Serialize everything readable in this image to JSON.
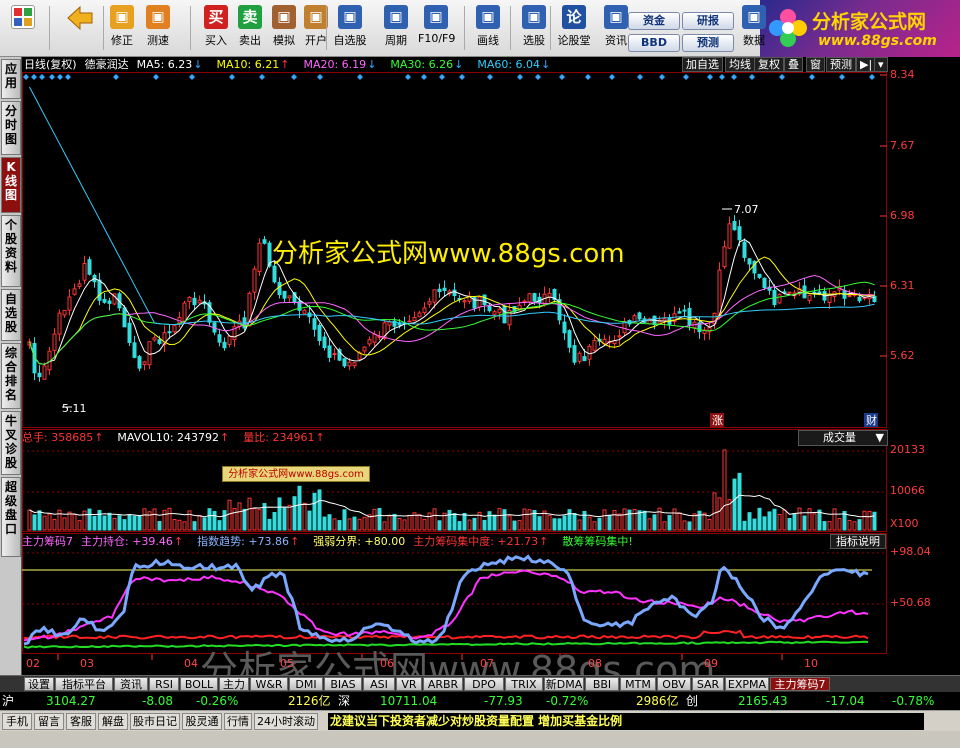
{
  "toolbar": {
    "buttons": [
      {
        "key": "modify",
        "label": "修正",
        "icon": "up-down-arrows-icon",
        "color": "#e8a020"
      },
      {
        "key": "measure",
        "label": "测速",
        "icon": "stopwatch-icon",
        "color": "#e08020"
      },
      {
        "key": "buy",
        "label": "买入",
        "icon_text": "买",
        "color": "#d02020"
      },
      {
        "key": "sell",
        "label": "卖出",
        "icon_text": "卖",
        "color": "#20a040"
      },
      {
        "key": "simulate",
        "label": "模拟",
        "icon": "hammer-icon",
        "color": "#a06030"
      },
      {
        "key": "open",
        "label": "开户",
        "icon": "lock-icon",
        "color": "#c08030"
      },
      {
        "key": "watchlist",
        "label": "自选股",
        "icon": "star-window-icon",
        "color": "#3060b0"
      },
      {
        "key": "period",
        "label": "周期",
        "icon": "clock-icon",
        "color": "#3060b0"
      },
      {
        "key": "f10",
        "label": "F10/F9",
        "icon": "document-window-icon",
        "color": "#3060b0"
      },
      {
        "key": "draw",
        "label": "画线",
        "icon": "pencil-icon",
        "color": "#3060b0"
      },
      {
        "key": "pick",
        "label": "选股",
        "icon": "chart-window-icon",
        "color": "#3060b0"
      },
      {
        "key": "forum",
        "label": "论股堂",
        "icon_text": "论",
        "color": "#2050a0"
      },
      {
        "key": "news",
        "label": "资讯",
        "icon": "globe-icon",
        "color": "#3060b0"
      },
      {
        "key": "data",
        "label": "数据",
        "icon": "pe-icon",
        "color": "#3060b0"
      }
    ],
    "pills": [
      "资金",
      "研报",
      "BBD",
      "预测"
    ]
  },
  "logo": {
    "title": "分析家公式网",
    "url": "www.88gs.com"
  },
  "sidebar": [
    "应用",
    "分时图",
    "K线图",
    "个股资料",
    "自选股",
    "综合排名",
    "牛叉诊股",
    "超级盘口"
  ],
  "legend_main": [
    {
      "text": "日线(复权)",
      "color": "#ffffff"
    },
    {
      "text": "德豪润达",
      "color": "#ffffff"
    },
    {
      "text": "MA5: 6.23",
      "color": "#ffffff",
      "arrow": "↓",
      "arrow_color": "#33aaff"
    },
    {
      "text": "MA10: 6.21",
      "color": "#ffff00",
      "arrow": "↑",
      "arrow_color": "#ff3333"
    },
    {
      "text": "MA20: 6.19",
      "color": "#ff66ff",
      "arrow": "↓",
      "arrow_color": "#33aaff"
    },
    {
      "text": "MA30: 6.26",
      "color": "#33ff33",
      "arrow": "↓",
      "arrow_color": "#33aaff"
    },
    {
      "text": "MA60: 6.04",
      "color": "#33ccff",
      "arrow": "↓",
      "arrow_color": "#33aaff"
    }
  ],
  "chart_buttons": [
    "加自选",
    "均线",
    "复权",
    "叠",
    "窗",
    "预测"
  ],
  "price_axis": [
    "8.34",
    "7.67",
    "6.98",
    "6.31",
    "5.62"
  ],
  "annotations": {
    "high": "7.07",
    "low": "5.11",
    "rise": "涨",
    "fin": "财"
  },
  "watermark_main": "分析家公式网www.88gs.com",
  "watermark_box": "分析家公式网www.88gs.com",
  "watermark_indicator": "分析家公式网www.88gs.com",
  "legend_volume": [
    {
      "text": "总手: 358685",
      "color": "#ff3333",
      "arrow": "↑",
      "arrow_color": "#ff3333"
    },
    {
      "text": "MAVOL10: 243792",
      "color": "#ffffff",
      "arrow": "↑",
      "arrow_color": "#ff3333"
    },
    {
      "text": "量比: 234961",
      "color": "#ff3333",
      "arrow": "↑",
      "arrow_color": "#ff3333"
    }
  ],
  "volume_dropdown": "成交量",
  "volume_axis": [
    "20133",
    "10066",
    "X100"
  ],
  "legend_indicator": [
    {
      "text": "主力筹码7",
      "color": "#ff66ff"
    },
    {
      "text": "主力持仓: +39.46",
      "color": "#ff66ff",
      "arrow": "↑",
      "arrow_color": "#ff3333"
    },
    {
      "text": "指数趋势: +73.86",
      "color": "#8ab4ff",
      "arrow": "↑",
      "arrow_color": "#ff3333"
    },
    {
      "text": "强弱分界: +80.00",
      "color": "#ffff66"
    },
    {
      "text": "主力筹码集中度: +21.73",
      "color": "#ff3333",
      "arrow": "↑",
      "arrow_color": "#ff3333"
    },
    {
      "text": "散筹筹码集中!",
      "color": "#33ff33"
    }
  ],
  "indicator_help": "指标说明",
  "indicator_axis": [
    "+98.04",
    "+50.68"
  ],
  "months": [
    "02",
    "03",
    "04",
    "05",
    "06",
    "07",
    "08",
    "09",
    "10"
  ],
  "tabs": [
    "设置",
    "指标平台",
    "资讯",
    "RSI",
    "BOLL",
    "主力",
    "W&R",
    "DMI",
    "BIAS",
    "ASI",
    "VR",
    "ARBR",
    "DPO",
    "TRIX",
    "新DMA",
    "BBI",
    "MTM",
    "OBV",
    "SAR",
    "EXPMA",
    "主力筹码7"
  ],
  "quotes": {
    "sh_label": "沪",
    "sh_index": "3104.27",
    "sh_change": "-8.08",
    "sh_pct": "-0.26%",
    "sh_amount": "2126亿",
    "sz_label": "深",
    "sz_index": "10711.04",
    "sz_change": "-77.93",
    "sz_pct": "-0.72%",
    "sz_amount": "2986亿",
    "cy_label": "创",
    "cy_index": "2165.43",
    "cy_change": "-17.04",
    "cy_pct": "-0.78%"
  },
  "status_buttons": [
    "手机",
    "留言",
    "客服",
    "解盘",
    "股市日记",
    "股灵通",
    "行情",
    "24小时滚动"
  ],
  "marquee": "龙建议当下投资者减少对炒股资量配置 增加买基金比例",
  "colors": {
    "up": "#ff3333",
    "down": "#33dddd",
    "ma5": "#ffffff",
    "ma10": "#ffff00",
    "ma20": "#ff66ff",
    "ma30": "#33ff33",
    "ma60": "#33ccff",
    "grid": "#8b0000"
  }
}
